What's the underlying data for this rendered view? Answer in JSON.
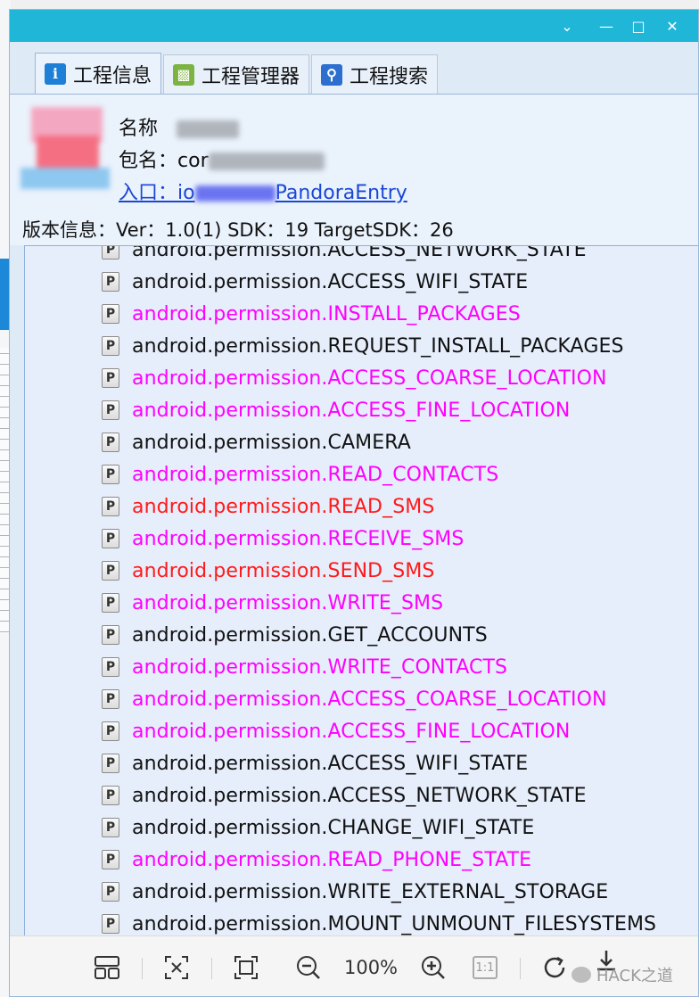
{
  "window": {
    "controls": [
      "chevron-down-icon",
      "minimize-icon",
      "maximize-icon",
      "close-icon"
    ]
  },
  "tabs": [
    {
      "label": "工程信息",
      "icon": "info-icon",
      "active": true,
      "color": "#1e7fd6"
    },
    {
      "label": "工程管理器",
      "icon": "android-icon",
      "active": false,
      "color": "#7cb342"
    },
    {
      "label": "工程搜索",
      "icon": "search-icon",
      "active": false,
      "color": "#2d6fcf"
    }
  ],
  "info": {
    "name_label": "名称",
    "package_label": "包名：",
    "package_visible": "cor",
    "entry_label": "入口：",
    "entry_prefix": "io",
    "entry_suffix": "PandoraEntry",
    "version": "版本信息：Ver：1.0(1) SDK：19 TargetSDK：26"
  },
  "colors": {
    "normal": "#111111",
    "magenta": "#ff00ff",
    "red": "#ff1a1a"
  },
  "permissions": [
    {
      "text": "android.permission.ACCESS_NETWORK_STATE",
      "color": "normal"
    },
    {
      "text": "android.permission.ACCESS_WIFI_STATE",
      "color": "normal"
    },
    {
      "text": "android.permission.INSTALL_PACKAGES",
      "color": "magenta"
    },
    {
      "text": "android.permission.REQUEST_INSTALL_PACKAGES",
      "color": "normal"
    },
    {
      "text": "android.permission.ACCESS_COARSE_LOCATION",
      "color": "magenta"
    },
    {
      "text": "android.permission.ACCESS_FINE_LOCATION",
      "color": "magenta"
    },
    {
      "text": "android.permission.CAMERA",
      "color": "normal"
    },
    {
      "text": "android.permission.READ_CONTACTS",
      "color": "magenta"
    },
    {
      "text": "android.permission.READ_SMS",
      "color": "red"
    },
    {
      "text": "android.permission.RECEIVE_SMS",
      "color": "magenta"
    },
    {
      "text": "android.permission.SEND_SMS",
      "color": "red"
    },
    {
      "text": "android.permission.WRITE_SMS",
      "color": "magenta"
    },
    {
      "text": "android.permission.GET_ACCOUNTS",
      "color": "normal"
    },
    {
      "text": "android.permission.WRITE_CONTACTS",
      "color": "magenta"
    },
    {
      "text": "android.permission.ACCESS_COARSE_LOCATION",
      "color": "magenta"
    },
    {
      "text": "android.permission.ACCESS_FINE_LOCATION",
      "color": "magenta"
    },
    {
      "text": "android.permission.ACCESS_WIFI_STATE",
      "color": "normal"
    },
    {
      "text": "android.permission.ACCESS_NETWORK_STATE",
      "color": "normal"
    },
    {
      "text": "android.permission.CHANGE_WIFI_STATE",
      "color": "normal"
    },
    {
      "text": "android.permission.READ_PHONE_STATE",
      "color": "magenta"
    },
    {
      "text": "android.permission.WRITE_EXTERNAL_STORAGE",
      "color": "normal"
    },
    {
      "text": "android.permission.MOUNT_UNMOUNT_FILESYSTEMS",
      "color": "normal"
    }
  ],
  "permission_icon_letter": "P",
  "toolbar": {
    "zoom": "100%",
    "actual_size": "1:1",
    "icons": [
      "layout-icon",
      "fit-selection-icon",
      "fit-window-icon",
      "zoom-out-icon",
      "zoom-in-icon",
      "actual-size-icon",
      "rotate-icon",
      "download-icon"
    ]
  },
  "watermark": "HACK之道"
}
